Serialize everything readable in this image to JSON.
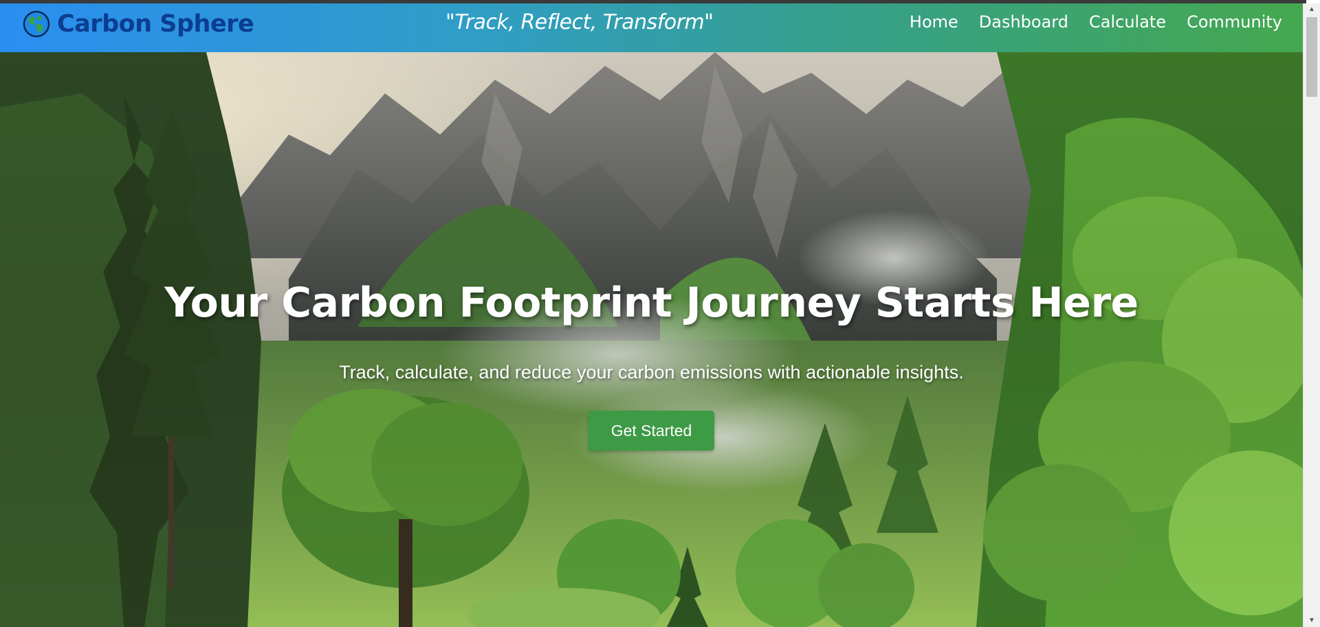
{
  "navbar": {
    "brand_name": "Carbon Sphere",
    "brand_icon": "globe-icon",
    "tagline": "\"Track, Reflect, Transform\"",
    "links": [
      {
        "label": "Home"
      },
      {
        "label": "Dashboard"
      },
      {
        "label": "Calculate"
      },
      {
        "label": "Community"
      }
    ]
  },
  "hero": {
    "title": "Your Carbon Footprint Journey Starts Here",
    "subtitle": "Track, calculate, and reduce your carbon emissions with actionable insights.",
    "cta_label": "Get Started",
    "background_image": "mountain-forest-landscape"
  },
  "colors": {
    "brand_text": "#0b3d91",
    "nav_gradient_start": "#2a8ef0",
    "nav_gradient_end": "#45a84f",
    "cta_background": "#3d9a45",
    "text_light": "#ffffff"
  },
  "scrollbar": {
    "up_icon": "scroll-up-arrow-icon",
    "down_icon": "scroll-down-arrow-icon"
  }
}
